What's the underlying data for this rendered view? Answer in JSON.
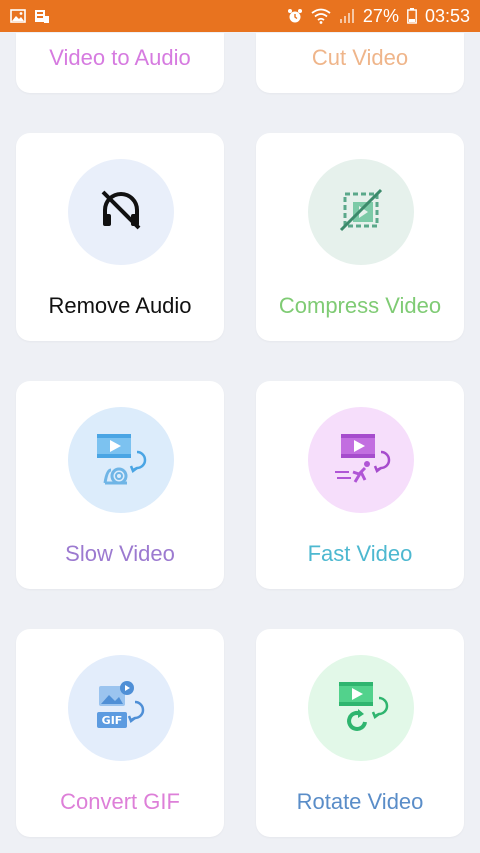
{
  "status_bar": {
    "battery": "27%",
    "time": "03:53",
    "icons": [
      "gallery-icon",
      "notification-icon",
      "alarm-icon",
      "wifi-icon",
      "signal-icon",
      "battery-icon"
    ]
  },
  "tools": [
    {
      "label": "Video to Audio",
      "color": "#d67be0"
    },
    {
      "label": "Cut Video",
      "color": "#efb58a"
    },
    {
      "label": "Remove Audio",
      "color": "#111111",
      "icon": "headphones-off-icon",
      "circle": "#e9effa"
    },
    {
      "label": "Compress Video",
      "color": "#7fcb74",
      "icon": "compress-video-icon",
      "circle": "#e6f1ec"
    },
    {
      "label": "Slow Video",
      "color": "#9c7ad0",
      "icon": "slow-video-icon",
      "circle": "#dcecfb"
    },
    {
      "label": "Fast Video",
      "color": "#4db8d0",
      "icon": "fast-video-icon",
      "circle": "#f6defb"
    },
    {
      "label": "Convert GIF",
      "color": "#dd7fd8",
      "icon": "gif-convert-icon",
      "circle": "#e3edfb"
    },
    {
      "label": "Rotate Video",
      "color": "#5a8dc8",
      "icon": "rotate-video-icon",
      "circle": "#e2f8e8"
    }
  ]
}
